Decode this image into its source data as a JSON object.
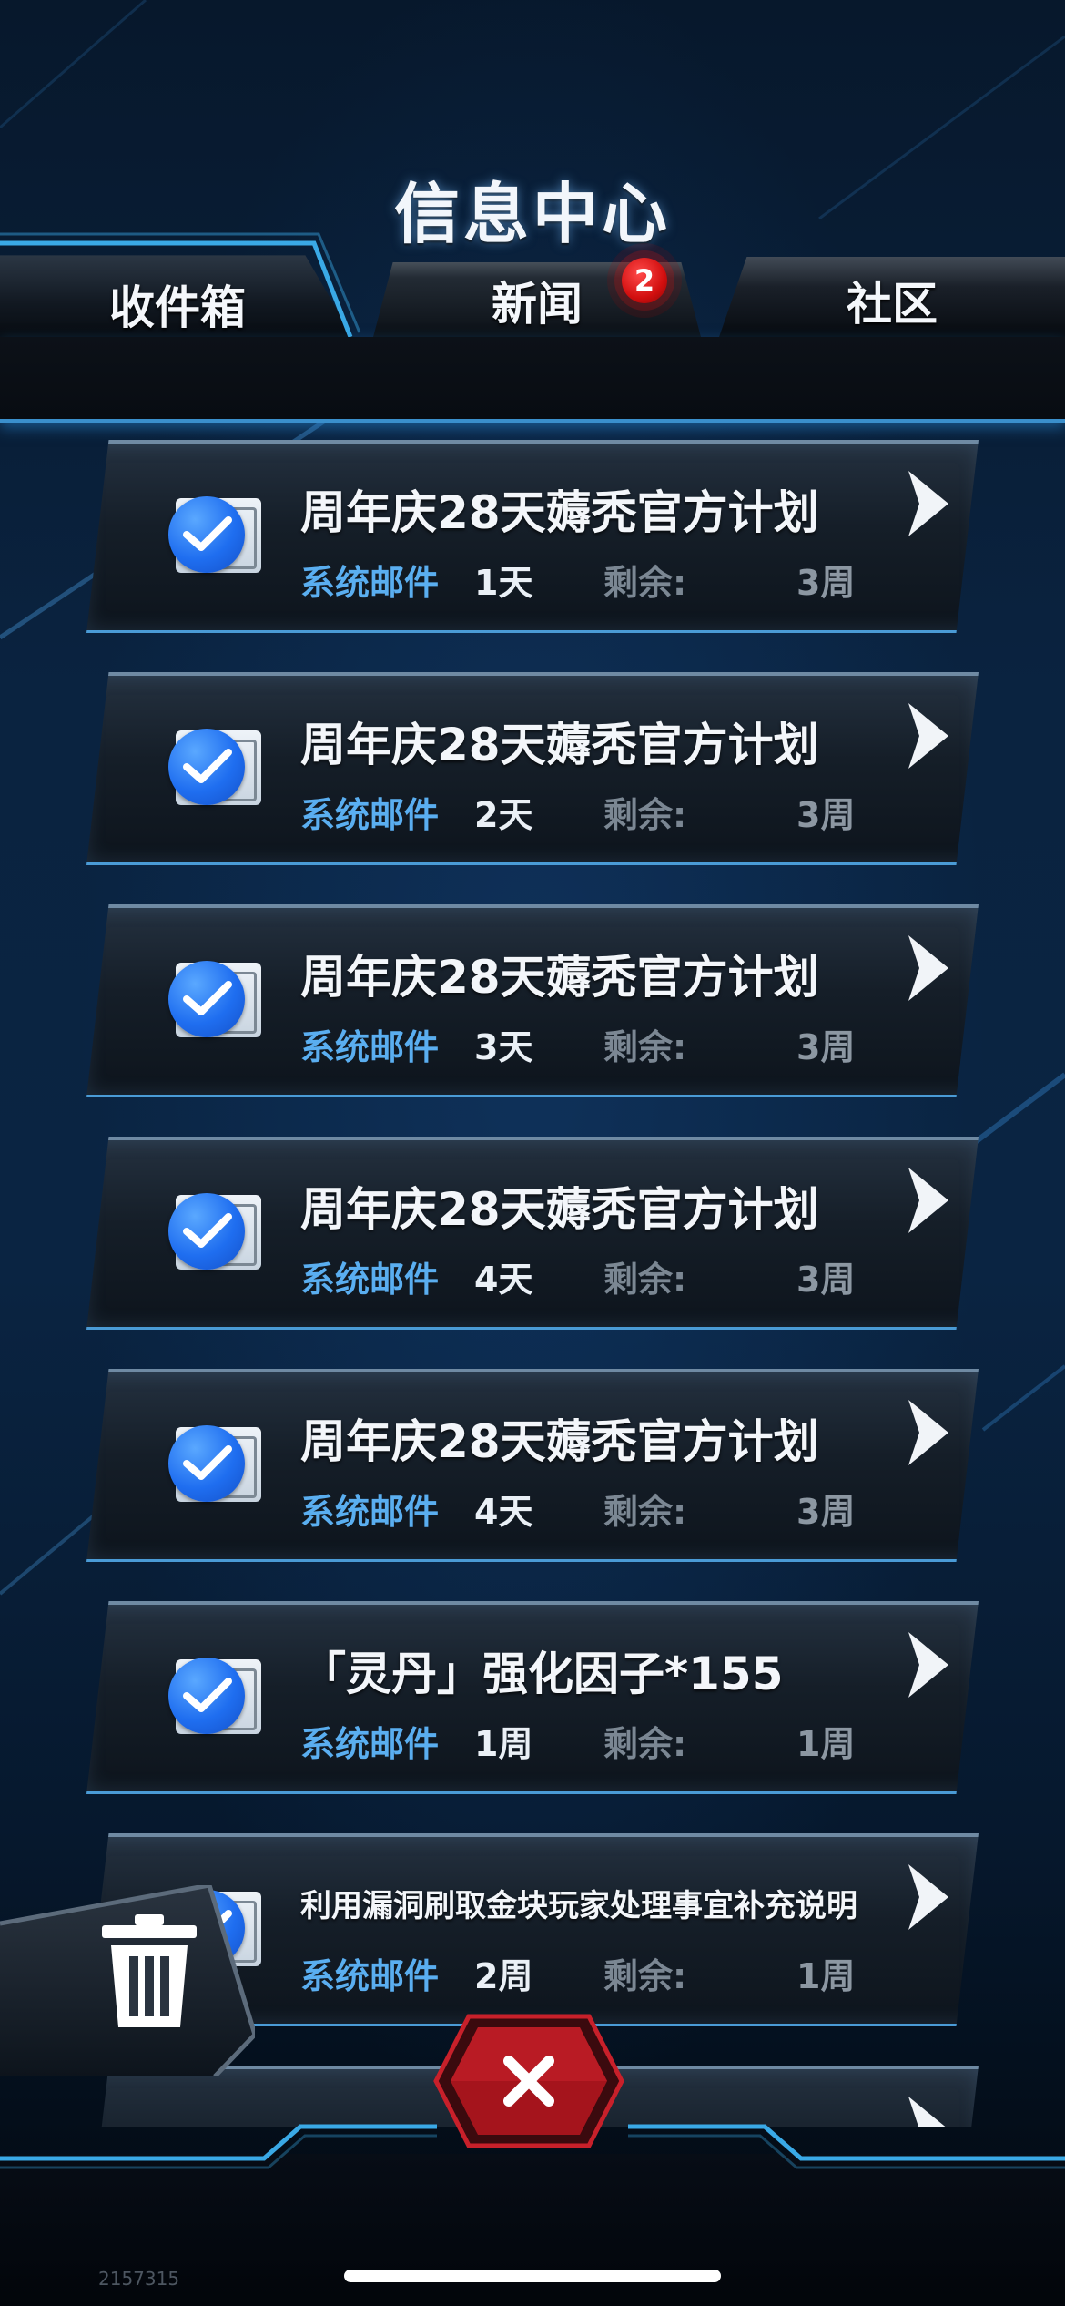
{
  "header": {
    "title": "信息中心"
  },
  "tabs": [
    {
      "label": "收件箱",
      "active": true
    },
    {
      "label": "新闻",
      "badge": "2"
    },
    {
      "label": "社区"
    }
  ],
  "mails": [
    {
      "title": "周年庆28天薅秃官方计划",
      "sender": "系统邮件",
      "age": "1天",
      "remaining_label": "剩余:",
      "remaining": "3周"
    },
    {
      "title": "周年庆28天薅秃官方计划",
      "sender": "系统邮件",
      "age": "2天",
      "remaining_label": "剩余:",
      "remaining": "3周"
    },
    {
      "title": "周年庆28天薅秃官方计划",
      "sender": "系统邮件",
      "age": "3天",
      "remaining_label": "剩余:",
      "remaining": "3周"
    },
    {
      "title": "周年庆28天薅秃官方计划",
      "sender": "系统邮件",
      "age": "4天",
      "remaining_label": "剩余:",
      "remaining": "3周"
    },
    {
      "title": "周年庆28天薅秃官方计划",
      "sender": "系统邮件",
      "age": "4天",
      "remaining_label": "剩余:",
      "remaining": "3周"
    },
    {
      "title": "「灵丹」强化因子*155",
      "sender": "系统邮件",
      "age": "1周",
      "remaining_label": "剩余:",
      "remaining": "1周"
    },
    {
      "title": "利用漏洞刷取金块玩家处理事宜补充说明",
      "sender": "系统邮件",
      "age": "2周",
      "remaining_label": "剩余:",
      "remaining": "1周"
    }
  ],
  "footer": {
    "build_id": "2157315"
  },
  "icons": {
    "trash": "trash-icon",
    "close": "close-icon",
    "arrow": "chevron-right-icon",
    "check": "check-icon"
  },
  "colors": {
    "accent": "#3aa9e6",
    "sender": "#5aaef0",
    "badge": "#d20f0f",
    "close": "#b0161e"
  }
}
